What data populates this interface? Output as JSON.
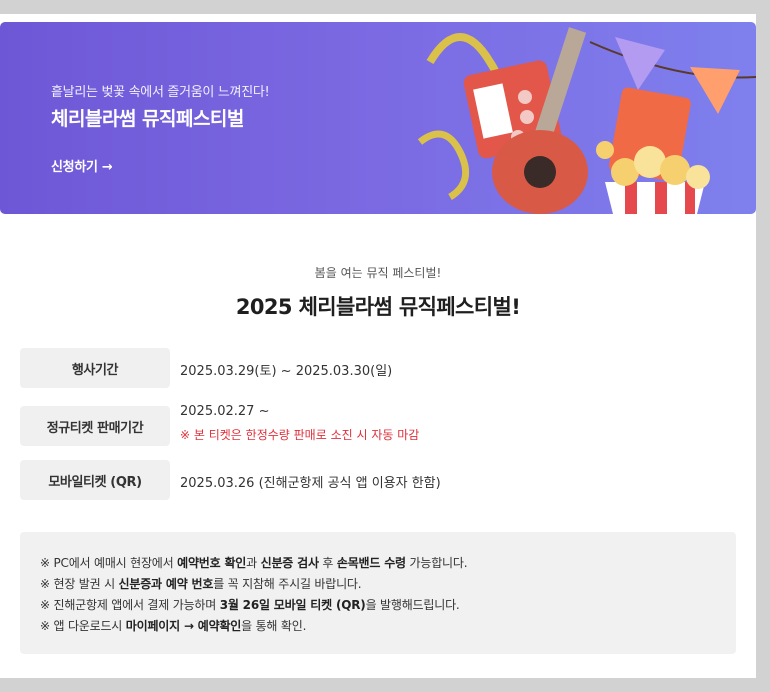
{
  "banner": {
    "subtitle": "흩날리는 벚꽃 속에서 즐거움이 느껴진다!",
    "title": "체리블라썸 뮤직페스티벌",
    "cta": "신청하기 →",
    "colors": {
      "gradient_start": "#6e57d6",
      "gradient_end": "#7f80ee"
    }
  },
  "headline": {
    "subtitle": "봄을 여는 뮤직 페스티벌!",
    "title": "2025 체리블라썸 뮤직페스티벌!"
  },
  "info": {
    "event_period": {
      "label": "행사기간",
      "value": "2025.03.29(토) ~ 2025.03.30(일)"
    },
    "ticket_period": {
      "label": "정규티켓 판매기간",
      "value": "2025.02.27 ~",
      "note": "※ 본 티켓은 한정수량 판매로 소진 시 자동 마감"
    },
    "mobile_ticket": {
      "label": "모바일티켓 (QR)",
      "value": "2025.03.26 (진해군항제 공식 앱 이용자 한함)"
    }
  },
  "notice": {
    "bullet": "※",
    "line1": {
      "a": "PC에서 예매시 현장에서 ",
      "b": "예약번호 확인",
      "c": "과 ",
      "d": "신분증 검사",
      "e": " 후 ",
      "f": "손목밴드 수령",
      "g": " 가능합니다."
    },
    "line2": {
      "a": "현장 발권 시 ",
      "b": "신분증과 예약 번호",
      "c": "를 꼭 지참해 주시길 바랍니다."
    },
    "line3": {
      "a": "진해군항제 앱에서 결제 가능하며 ",
      "b": "3월 26일 모바일 티켓 (QR)",
      "c": "을 발행해드립니다."
    },
    "line4": {
      "a": "앱 다운로드시 ",
      "b": "마이페이지 → 예약확인",
      "c": "을 통해 확인."
    }
  },
  "colors": {
    "warning": "#e0303b",
    "label_bg": "#f0f0f1"
  }
}
